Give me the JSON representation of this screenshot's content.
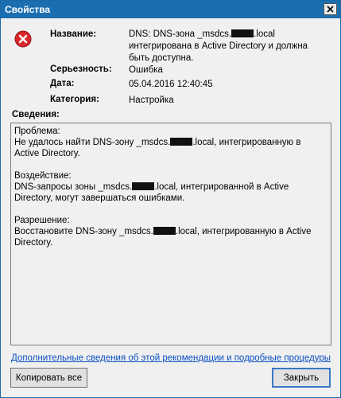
{
  "window": {
    "title": "Свойства"
  },
  "icons": {
    "error": "error-icon",
    "close": "close-icon"
  },
  "fields": {
    "name_label": "Название:",
    "name_value_prefix": "DNS: DNS-зона _msdcs.",
    "name_value_suffix": ".local",
    "name_value_rest": "интегрирована в Active Directory и должна быть доступна.",
    "severity_label": "Серьезность:",
    "severity_value": "Ошибка",
    "date_label": "Дата:",
    "date_value": "05.04.2016 12:40:45",
    "category_label": "Категория:",
    "category_value": "Настройка"
  },
  "details": {
    "heading": "Сведения:",
    "problem_label": "Проблема:",
    "problem_prefix": "Не удалось найти DNS-зону _msdcs.",
    "problem_suffix": ".local, интегрированную в Active Directory.",
    "impact_label": "Воздействие:",
    "impact_prefix": "DNS-запросы зоны _msdcs.",
    "impact_suffix": ".local, интегрированной в Active Directory, могут завершаться ошибками.",
    "resolution_label": "Разрешение:",
    "resolution_prefix": "Восстановите DNS-зону _msdcs.",
    "resolution_suffix": ".local, интегрированную в Active Directory."
  },
  "link_text": "Дополнительные сведения об этой рекомендации и подробные процедуры",
  "buttons": {
    "copy_all": "Копировать все",
    "close": "Закрыть"
  }
}
